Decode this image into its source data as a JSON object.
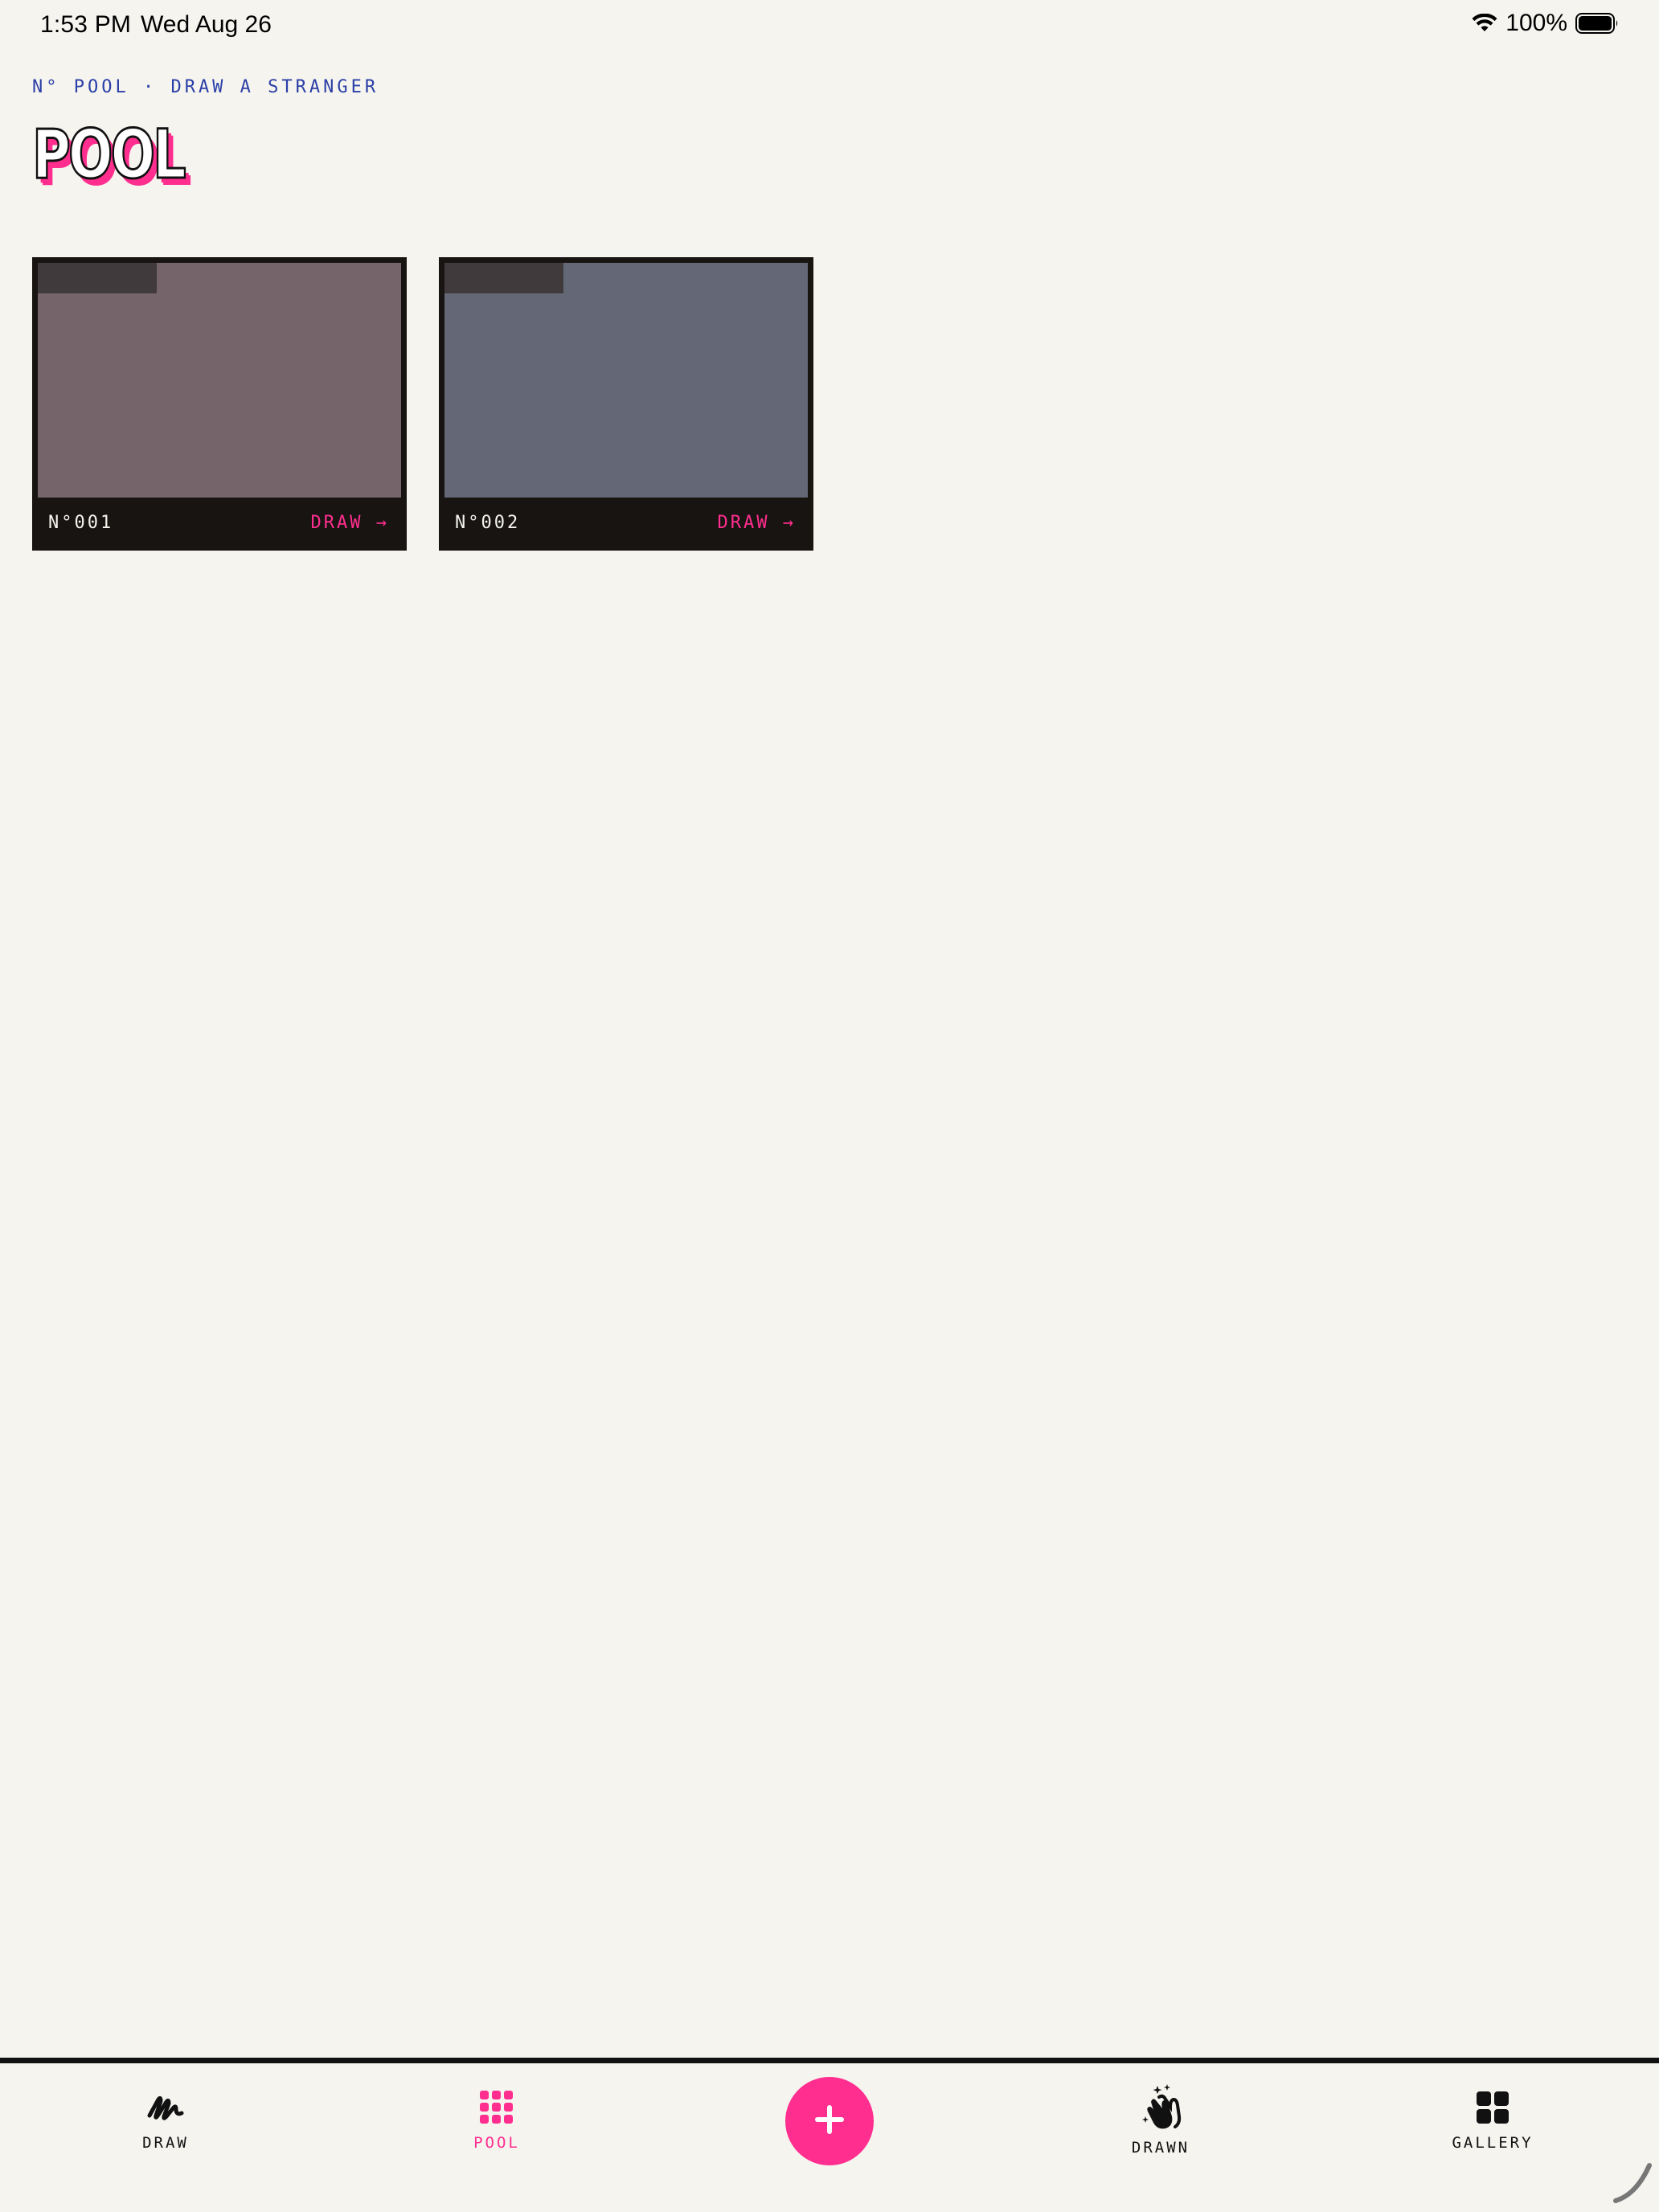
{
  "status_bar": {
    "time": "1:53 PM",
    "date": "Wed Aug 26",
    "battery": "100%",
    "icons": [
      "wifi-icon",
      "battery-icon"
    ]
  },
  "header": {
    "eyebrow": "N° POOL · DRAW A STRANGER",
    "title": "POOL"
  },
  "cards": [
    {
      "number": "N°001",
      "action": "DRAW →",
      "image_color": "#75646a",
      "tab_color": "#403a3d"
    },
    {
      "number": "N°002",
      "action": "DRAW →",
      "image_color": "#646876",
      "tab_color": "#403a3d"
    }
  ],
  "tabbar": {
    "tabs": [
      {
        "label": "DRAW",
        "icon": "scribble-icon",
        "active": false
      },
      {
        "label": "POOL",
        "icon": "grid-dots-icon",
        "active": true
      },
      {
        "label": "DRAWN",
        "icon": "clapping-hands-icon",
        "active": false
      },
      {
        "label": "GALLERY",
        "icon": "four-squares-icon",
        "active": false
      }
    ],
    "fab_icon": "plus-icon"
  },
  "colors": {
    "background": "#f5f4ef",
    "accent_pink": "#ff2e8f",
    "eyebrow_blue": "#2b3fa6",
    "card_frame": "#171411"
  }
}
